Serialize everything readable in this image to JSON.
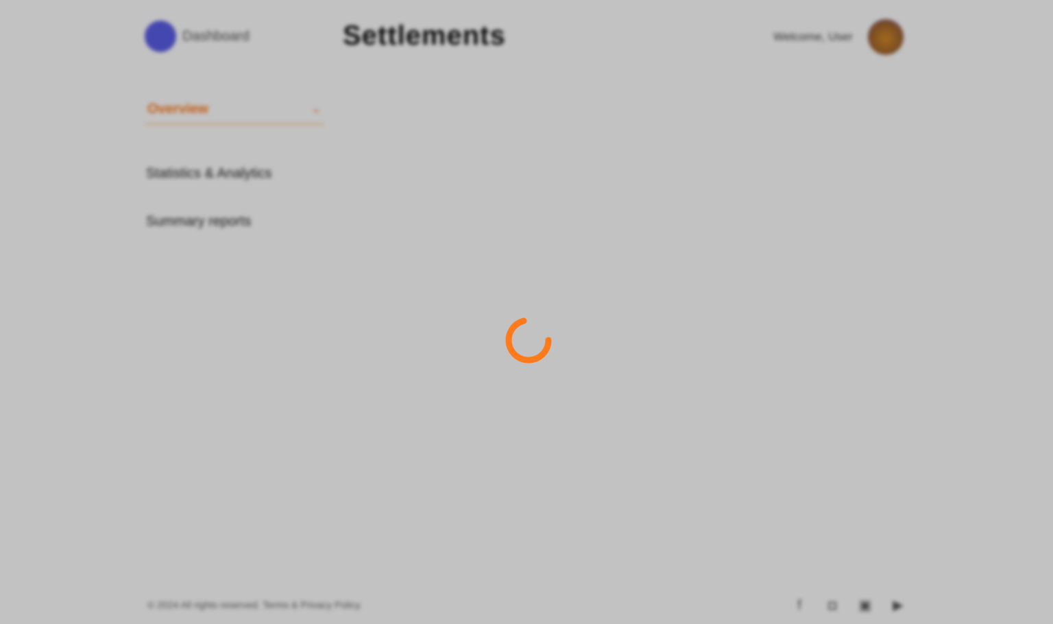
{
  "header": {
    "brand_name": "Dashboard",
    "title": "Settlements",
    "user_name": "Welcome, User"
  },
  "sidebar": {
    "dropdown_label": "Overview",
    "dropdown_icon": "chevron-down-icon",
    "links": [
      "Statistics & Analytics",
      "Summary reports"
    ]
  },
  "footer": {
    "copyright": "© 2024 All rights reserved. Terms & Privacy Policy.",
    "social_icons": [
      "facebook-icon",
      "instagram-icon",
      "linkedin-icon",
      "youtube-icon"
    ]
  },
  "overlay": {
    "state": "loading",
    "accent_color": "#ff7a1a"
  }
}
